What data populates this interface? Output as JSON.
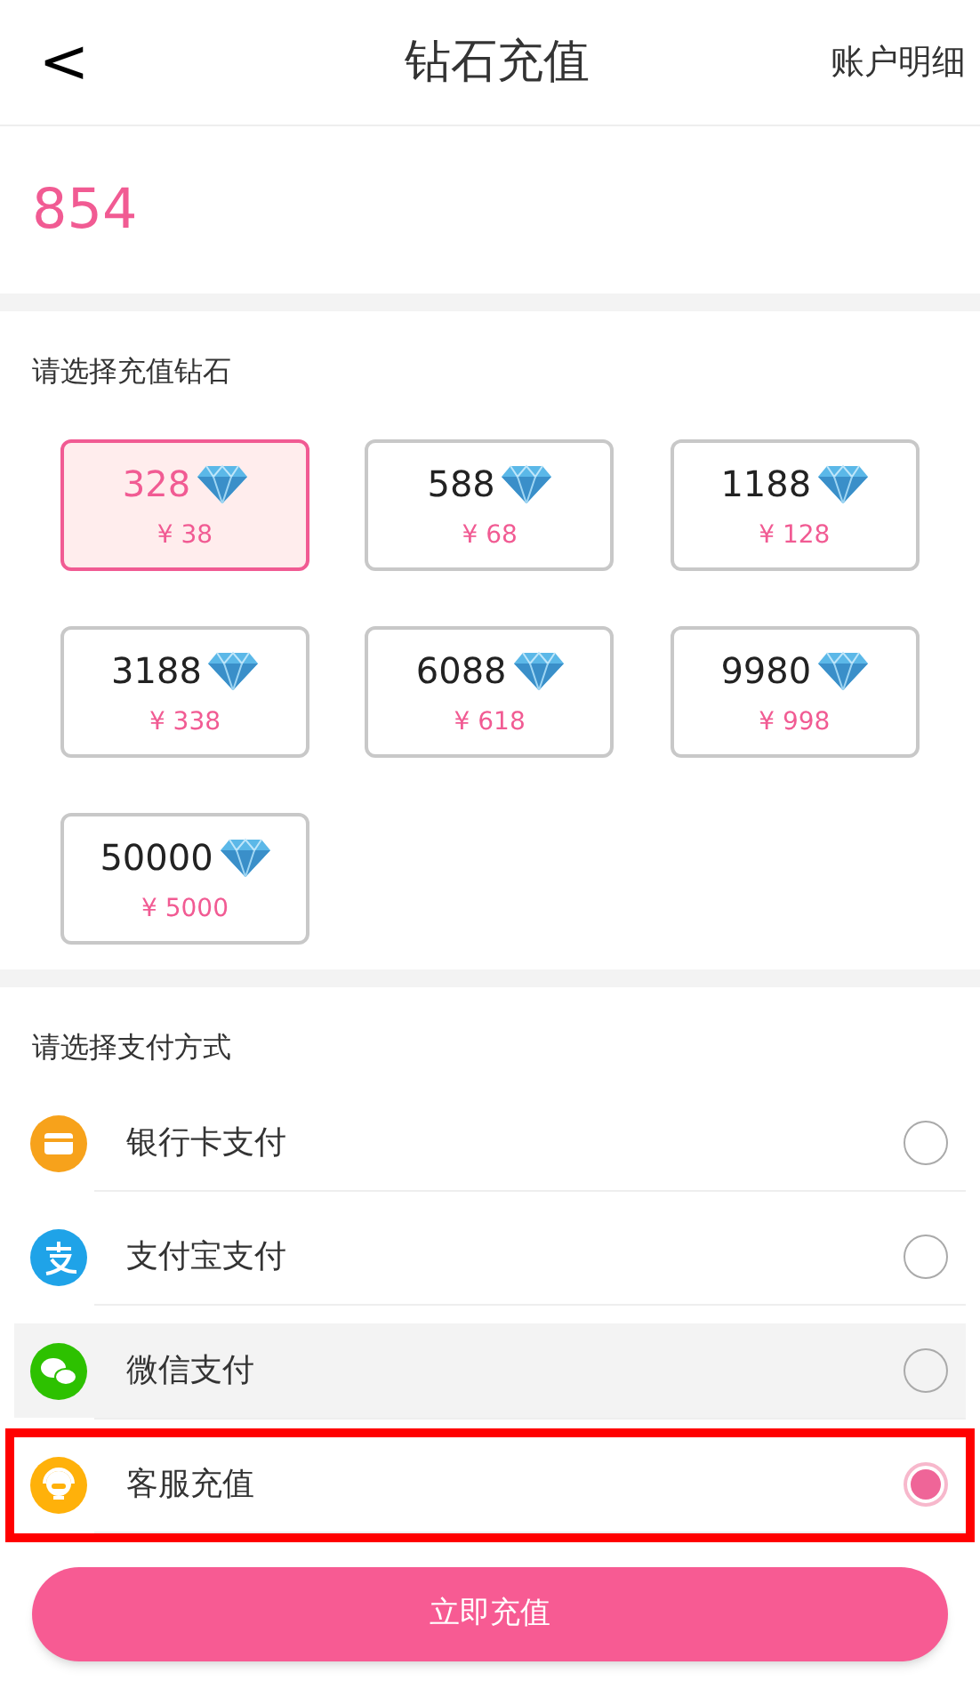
{
  "header": {
    "back": "<",
    "title": "钻石充值",
    "action": "账户明细"
  },
  "balance": {
    "value": "854"
  },
  "packages": {
    "title": "请选择充值钻石",
    "items": [
      {
        "diamonds": "328",
        "price": "¥ 38",
        "selected": true
      },
      {
        "diamonds": "588",
        "price": "¥ 68",
        "selected": false
      },
      {
        "diamonds": "1188",
        "price": "¥ 128",
        "selected": false
      },
      {
        "diamonds": "3188",
        "price": "¥ 338",
        "selected": false
      },
      {
        "diamonds": "6088",
        "price": "¥ 618",
        "selected": false
      },
      {
        "diamonds": "9980",
        "price": "¥ 998",
        "selected": false
      },
      {
        "diamonds": "50000",
        "price": "¥ 5000",
        "selected": false
      }
    ]
  },
  "payment": {
    "title": "请选择支付方式",
    "methods": [
      {
        "kind": "card",
        "label": "银行卡支付",
        "selected": false,
        "pressed": false,
        "highlighted": false
      },
      {
        "kind": "alipay",
        "label": "支付宝支付",
        "selected": false,
        "pressed": false,
        "highlighted": false
      },
      {
        "kind": "wechat",
        "label": "微信支付",
        "selected": false,
        "pressed": true,
        "highlighted": false
      },
      {
        "kind": "service",
        "label": "客服充值",
        "selected": true,
        "pressed": false,
        "highlighted": true
      }
    ]
  },
  "submit": {
    "label": "立即充值"
  }
}
